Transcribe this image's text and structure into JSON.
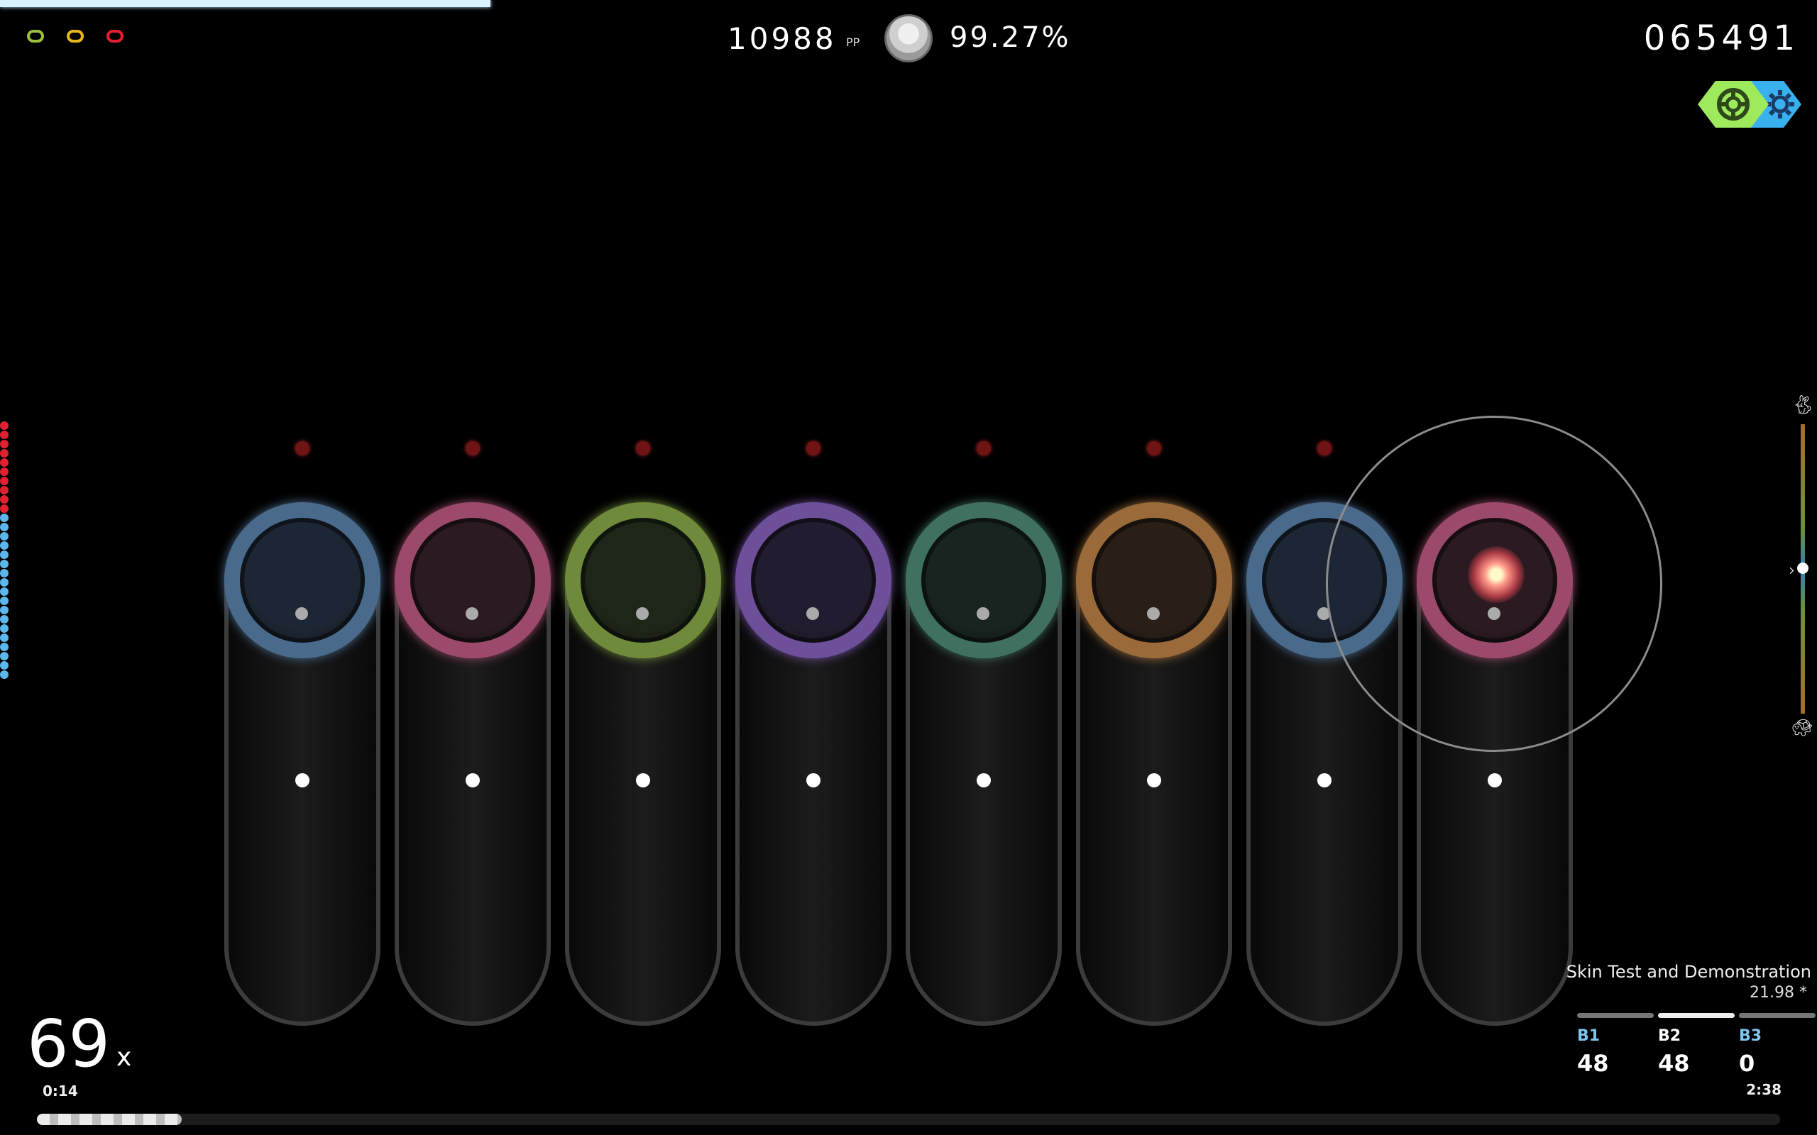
{
  "hud": {
    "pp_value": "10988",
    "pp_unit": "PP",
    "accuracy": "99.27%",
    "score": "065491"
  },
  "key_indicators": [
    {
      "color": "#9bbf3a"
    },
    {
      "color": "#e6b71c"
    },
    {
      "color": "#e3202f"
    }
  ],
  "mods": [
    {
      "icon": "lifebuoy-icon",
      "color": "#9ee95c"
    },
    {
      "icon": "gear-icon",
      "color": "#3ab1ef"
    }
  ],
  "health": {
    "fraction": 0.27
  },
  "columns": [
    {
      "ring": "#4a6a8c",
      "inner": "#1d2634"
    },
    {
      "ring": "#9c4a6b",
      "inner": "#2c1a22"
    },
    {
      "ring": "#6f8a3a",
      "inner": "#1e2617"
    },
    {
      "ring": "#6e4f9a",
      "inner": "#231c30"
    },
    {
      "ring": "#3f7060",
      "inner": "#17241f"
    },
    {
      "ring": "#9a6a3a",
      "inner": "#2a1f17"
    },
    {
      "ring": "#4a6a8c",
      "inner": "#1d2634"
    },
    {
      "ring": "#9c4a6b",
      "inner": "#2c1a22"
    }
  ],
  "hit_error": {
    "red_count": 10,
    "blue_count": 18,
    "red_color": "#e3202f",
    "blue_color": "#5ab8ef"
  },
  "combo": {
    "value": "69",
    "suffix": "x"
  },
  "time": {
    "elapsed": "0:14",
    "total": "2:38"
  },
  "song": {
    "title": "Skin Test and Demonstration",
    "stars": "21.98 *"
  },
  "breakdown": [
    {
      "label": "B1",
      "value": "48",
      "color": "#7fc6ef"
    },
    {
      "label": "B2",
      "value": "48",
      "color": "#ffffff"
    },
    {
      "label": "B3",
      "value": "0",
      "color": "#7fc6ef"
    }
  ],
  "progress": {
    "fraction": 0.083
  }
}
